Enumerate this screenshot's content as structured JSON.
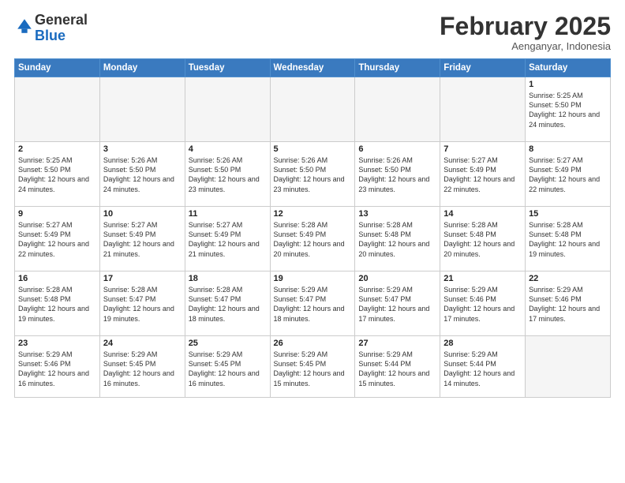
{
  "header": {
    "logo_general": "General",
    "logo_blue": "Blue",
    "month_title": "February 2025",
    "subtitle": "Aenganyar, Indonesia"
  },
  "days_of_week": [
    "Sunday",
    "Monday",
    "Tuesday",
    "Wednesday",
    "Thursday",
    "Friday",
    "Saturday"
  ],
  "weeks": [
    [
      {
        "day": "",
        "empty": true,
        "text": ""
      },
      {
        "day": "",
        "empty": true,
        "text": ""
      },
      {
        "day": "",
        "empty": true,
        "text": ""
      },
      {
        "day": "",
        "empty": true,
        "text": ""
      },
      {
        "day": "",
        "empty": true,
        "text": ""
      },
      {
        "day": "",
        "empty": true,
        "text": ""
      },
      {
        "day": "1",
        "empty": false,
        "text": "Sunrise: 5:25 AM\nSunset: 5:50 PM\nDaylight: 12 hours\nand 24 minutes."
      }
    ],
    [
      {
        "day": "2",
        "empty": false,
        "text": "Sunrise: 5:25 AM\nSunset: 5:50 PM\nDaylight: 12 hours\nand 24 minutes."
      },
      {
        "day": "3",
        "empty": false,
        "text": "Sunrise: 5:26 AM\nSunset: 5:50 PM\nDaylight: 12 hours\nand 24 minutes."
      },
      {
        "day": "4",
        "empty": false,
        "text": "Sunrise: 5:26 AM\nSunset: 5:50 PM\nDaylight: 12 hours\nand 23 minutes."
      },
      {
        "day": "5",
        "empty": false,
        "text": "Sunrise: 5:26 AM\nSunset: 5:50 PM\nDaylight: 12 hours\nand 23 minutes."
      },
      {
        "day": "6",
        "empty": false,
        "text": "Sunrise: 5:26 AM\nSunset: 5:50 PM\nDaylight: 12 hours\nand 23 minutes."
      },
      {
        "day": "7",
        "empty": false,
        "text": "Sunrise: 5:27 AM\nSunset: 5:49 PM\nDaylight: 12 hours\nand 22 minutes."
      },
      {
        "day": "8",
        "empty": false,
        "text": "Sunrise: 5:27 AM\nSunset: 5:49 PM\nDaylight: 12 hours\nand 22 minutes."
      }
    ],
    [
      {
        "day": "9",
        "empty": false,
        "text": "Sunrise: 5:27 AM\nSunset: 5:49 PM\nDaylight: 12 hours\nand 22 minutes."
      },
      {
        "day": "10",
        "empty": false,
        "text": "Sunrise: 5:27 AM\nSunset: 5:49 PM\nDaylight: 12 hours\nand 21 minutes."
      },
      {
        "day": "11",
        "empty": false,
        "text": "Sunrise: 5:27 AM\nSunset: 5:49 PM\nDaylight: 12 hours\nand 21 minutes."
      },
      {
        "day": "12",
        "empty": false,
        "text": "Sunrise: 5:28 AM\nSunset: 5:49 PM\nDaylight: 12 hours\nand 20 minutes."
      },
      {
        "day": "13",
        "empty": false,
        "text": "Sunrise: 5:28 AM\nSunset: 5:48 PM\nDaylight: 12 hours\nand 20 minutes."
      },
      {
        "day": "14",
        "empty": false,
        "text": "Sunrise: 5:28 AM\nSunset: 5:48 PM\nDaylight: 12 hours\nand 20 minutes."
      },
      {
        "day": "15",
        "empty": false,
        "text": "Sunrise: 5:28 AM\nSunset: 5:48 PM\nDaylight: 12 hours\nand 19 minutes."
      }
    ],
    [
      {
        "day": "16",
        "empty": false,
        "text": "Sunrise: 5:28 AM\nSunset: 5:48 PM\nDaylight: 12 hours\nand 19 minutes."
      },
      {
        "day": "17",
        "empty": false,
        "text": "Sunrise: 5:28 AM\nSunset: 5:47 PM\nDaylight: 12 hours\nand 19 minutes."
      },
      {
        "day": "18",
        "empty": false,
        "text": "Sunrise: 5:28 AM\nSunset: 5:47 PM\nDaylight: 12 hours\nand 18 minutes."
      },
      {
        "day": "19",
        "empty": false,
        "text": "Sunrise: 5:29 AM\nSunset: 5:47 PM\nDaylight: 12 hours\nand 18 minutes."
      },
      {
        "day": "20",
        "empty": false,
        "text": "Sunrise: 5:29 AM\nSunset: 5:47 PM\nDaylight: 12 hours\nand 17 minutes."
      },
      {
        "day": "21",
        "empty": false,
        "text": "Sunrise: 5:29 AM\nSunset: 5:46 PM\nDaylight: 12 hours\nand 17 minutes."
      },
      {
        "day": "22",
        "empty": false,
        "text": "Sunrise: 5:29 AM\nSunset: 5:46 PM\nDaylight: 12 hours\nand 17 minutes."
      }
    ],
    [
      {
        "day": "23",
        "empty": false,
        "text": "Sunrise: 5:29 AM\nSunset: 5:46 PM\nDaylight: 12 hours\nand 16 minutes."
      },
      {
        "day": "24",
        "empty": false,
        "text": "Sunrise: 5:29 AM\nSunset: 5:45 PM\nDaylight: 12 hours\nand 16 minutes."
      },
      {
        "day": "25",
        "empty": false,
        "text": "Sunrise: 5:29 AM\nSunset: 5:45 PM\nDaylight: 12 hours\nand 16 minutes."
      },
      {
        "day": "26",
        "empty": false,
        "text": "Sunrise: 5:29 AM\nSunset: 5:45 PM\nDaylight: 12 hours\nand 15 minutes."
      },
      {
        "day": "27",
        "empty": false,
        "text": "Sunrise: 5:29 AM\nSunset: 5:44 PM\nDaylight: 12 hours\nand 15 minutes."
      },
      {
        "day": "28",
        "empty": false,
        "text": "Sunrise: 5:29 AM\nSunset: 5:44 PM\nDaylight: 12 hours\nand 14 minutes."
      },
      {
        "day": "",
        "empty": true,
        "text": ""
      }
    ]
  ]
}
